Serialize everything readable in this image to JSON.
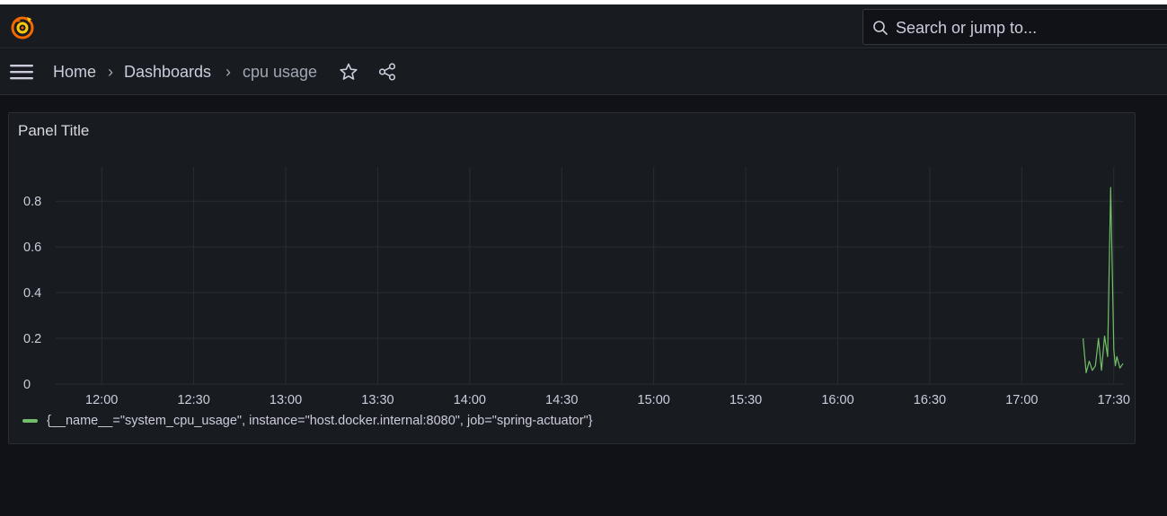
{
  "search": {
    "placeholder": "Search or jump to..."
  },
  "breadcrumb": {
    "home": "Home",
    "separator": "›",
    "dashboards": "Dashboards",
    "current": "cpu usage"
  },
  "panel": {
    "title": "Panel Title"
  },
  "colors": {
    "background": "#111217",
    "panel": "#181b1f",
    "series": "#73bf69",
    "grid": "#2a2d33"
  },
  "icons": {
    "logo": "grafana-logo-icon",
    "search": "search-icon",
    "menu": "hamburger-menu-icon",
    "star": "star-icon",
    "share": "share-icon"
  },
  "chart_data": {
    "type": "line",
    "title": "Panel Title",
    "xlabel": "",
    "ylabel": "",
    "x_ticks": [
      "12:00",
      "12:30",
      "13:00",
      "13:30",
      "14:00",
      "14:30",
      "15:00",
      "15:30",
      "16:00",
      "16:30",
      "17:00",
      "17:30"
    ],
    "y_ticks": [
      "0",
      "0.2",
      "0.4",
      "0.6",
      "0.8"
    ],
    "ylim": [
      0,
      0.95
    ],
    "xlim": [
      "11:45",
      "17:33"
    ],
    "grid": true,
    "legend_placement": "bottom-left",
    "series": [
      {
        "name": "{__name__=\"system_cpu_usage\", instance=\"host.docker.internal:8080\", job=\"spring-actuator\"}",
        "color": "#73bf69",
        "x": [
          "17:20",
          "17:21",
          "17:22",
          "17:23",
          "17:24",
          "17:25",
          "17:26",
          "17:27",
          "17:28",
          "17:29",
          "17:30",
          "17:30.5",
          "17:31",
          "17:32",
          "17:33"
        ],
        "y": [
          0.2,
          0.05,
          0.1,
          0.06,
          0.08,
          0.2,
          0.06,
          0.21,
          0.12,
          0.86,
          0.15,
          0.08,
          0.12,
          0.07,
          0.09
        ]
      }
    ]
  }
}
